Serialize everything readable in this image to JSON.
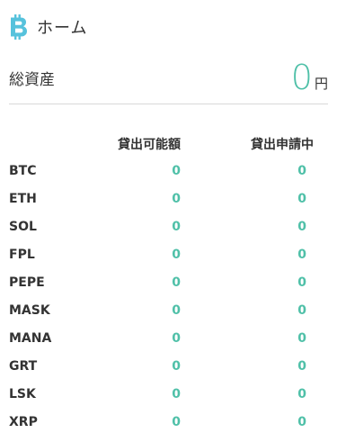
{
  "header": {
    "logo_icon": "bitcoin-logo-icon",
    "title": "ホーム"
  },
  "total_assets": {
    "label": "総資産",
    "amount": "0",
    "unit": "円"
  },
  "table": {
    "headers": {
      "available": "貸出可能額",
      "pending": "貸出申請中"
    },
    "rows": [
      {
        "symbol": "BTC",
        "available": "0",
        "pending": "0"
      },
      {
        "symbol": "ETH",
        "available": "0",
        "pending": "0"
      },
      {
        "symbol": "SOL",
        "available": "0",
        "pending": "0"
      },
      {
        "symbol": "FPL",
        "available": "0",
        "pending": "0"
      },
      {
        "symbol": "PEPE",
        "available": "0",
        "pending": "0"
      },
      {
        "symbol": "MASK",
        "available": "0",
        "pending": "0"
      },
      {
        "symbol": "MANA",
        "available": "0",
        "pending": "0"
      },
      {
        "symbol": "GRT",
        "available": "0",
        "pending": "0"
      },
      {
        "symbol": "LSK",
        "available": "0",
        "pending": "0"
      },
      {
        "symbol": "XRP",
        "available": "0",
        "pending": "0"
      }
    ]
  },
  "colors": {
    "accent": "#4fc0a8",
    "logo": "#56c2dc",
    "text": "#333333",
    "divider": "#d8d8d8"
  }
}
